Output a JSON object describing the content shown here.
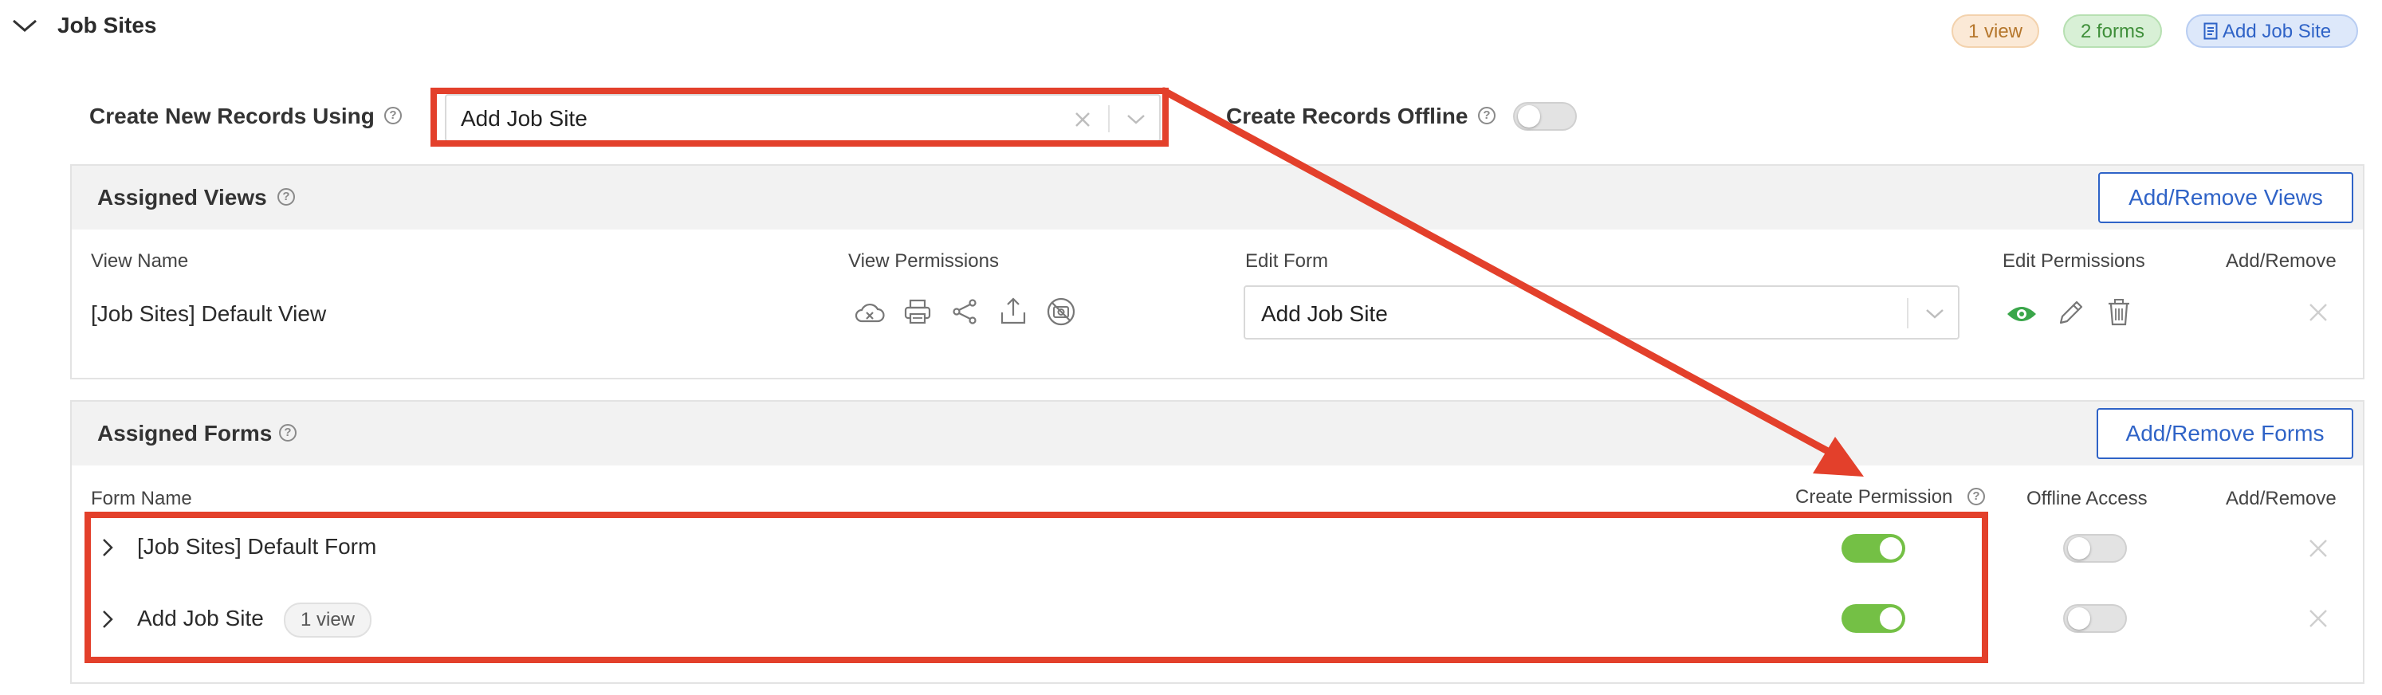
{
  "section": {
    "title": "Job Sites",
    "badges": {
      "views": "1 view",
      "forms": "2 forms",
      "add_job_site": "Add Job Site"
    }
  },
  "create_new": {
    "label": "Create New Records Using",
    "value": "Add Job Site",
    "offline_label": "Create Records Offline",
    "offline_enabled": false
  },
  "assigned_views": {
    "title": "Assigned Views",
    "button": "Add/Remove Views",
    "columns": [
      "View Name",
      "View Permissions",
      "Edit Form",
      "Edit Permissions",
      "Add/Remove"
    ],
    "rows": [
      {
        "name": "[Job Sites] Default View",
        "edit_form": "Add Job Site"
      }
    ]
  },
  "assigned_forms": {
    "title": "Assigned Forms",
    "button": "Add/Remove Forms",
    "columns": [
      "Form Name",
      "Create Permission",
      "Offline Access",
      "Add/Remove"
    ],
    "rows": [
      {
        "name": "[Job Sites] Default Form",
        "badge": "",
        "create_permission": true,
        "offline_access": false
      },
      {
        "name": "Add Job Site",
        "badge": "1 view",
        "create_permission": true,
        "offline_access": false
      }
    ]
  },
  "colors": {
    "accent_blue": "#2f63c7",
    "toggle_on": "#74c045",
    "annotation_red": "#e3402b",
    "badge_views_bg": "#fbe9d6",
    "badge_forms_bg": "#d8f0d6",
    "badge_add_bg": "#dde8fa"
  }
}
